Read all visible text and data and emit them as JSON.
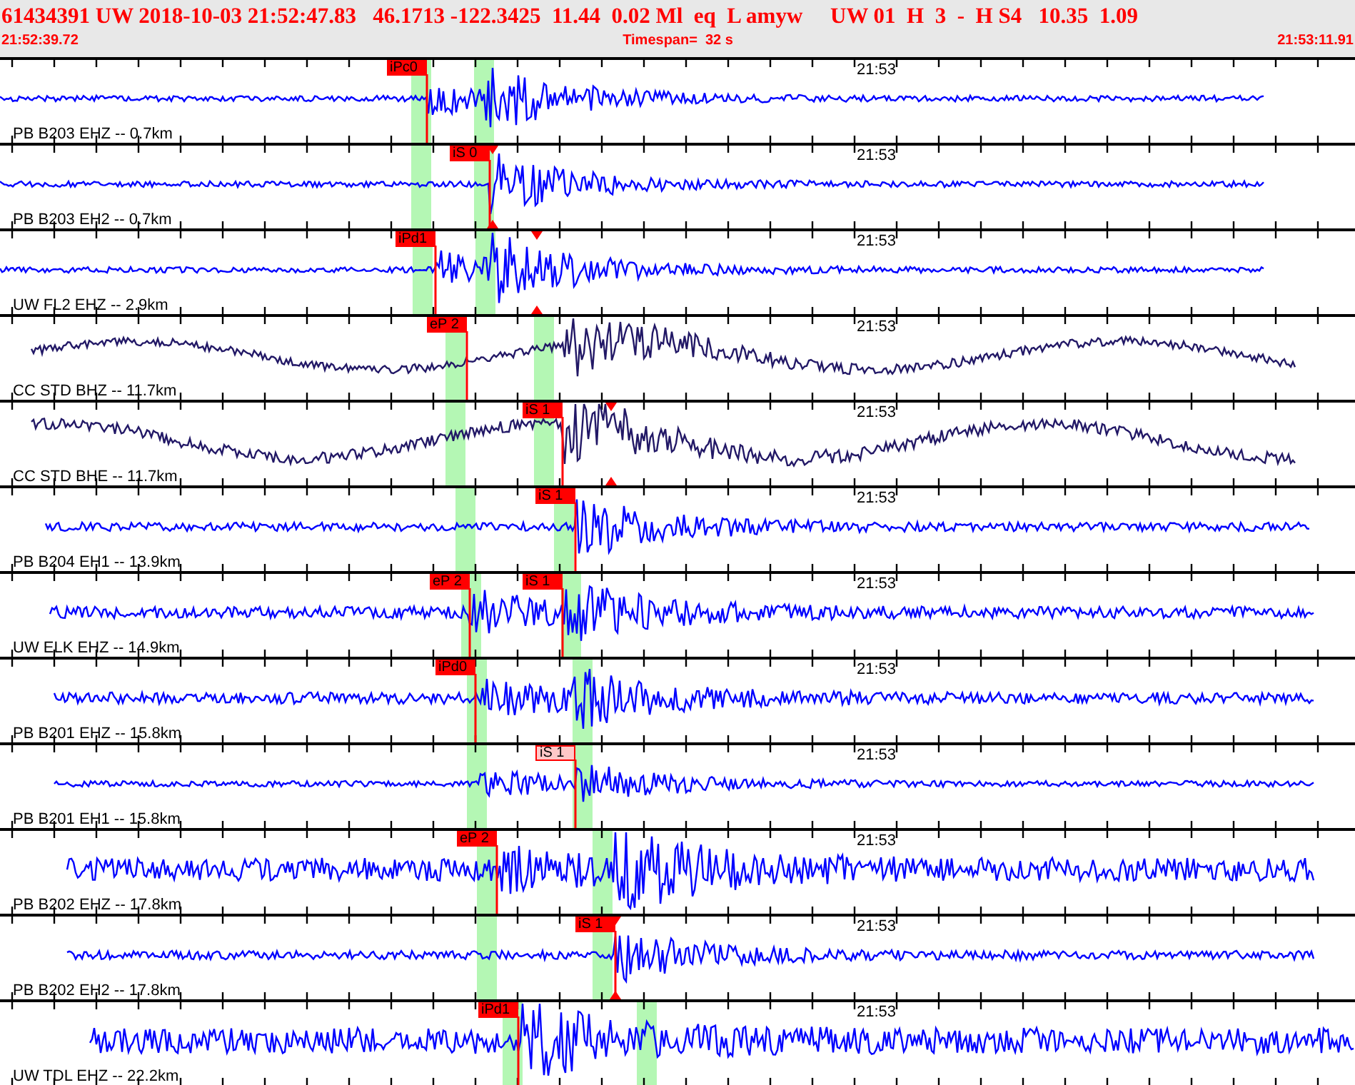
{
  "event_line": "61434391 UW 2018-10-03 21:52:47.83   46.1713 -122.3425  11.44  0.02 Ml  eq  L amyw     UW 01  H  3  -  H S4   10.35  1.09",
  "start_time": "21:52:39.72",
  "timespan": "Timespan=  32 s",
  "end_time": "21:53:11.91",
  "traces": [
    {
      "station": "PB B203 EHZ -- 0.7km",
      "time_label": "21:53",
      "color": "#0000ff",
      "picks": [
        {
          "label": "iPc0",
          "confirmed": true
        }
      ]
    },
    {
      "station": "PB B203 EH2 -- 0.7km",
      "time_label": "21:53",
      "color": "#0000ff",
      "picks": [
        {
          "label": "iS 0",
          "confirmed": true
        }
      ]
    },
    {
      "station": "UW FL2 EHZ -- 2.9km",
      "time_label": "21:53",
      "color": "#0000ff",
      "picks": [
        {
          "label": "iPd1",
          "confirmed": true
        }
      ]
    },
    {
      "station": "CC STD BHZ -- 11.7km",
      "time_label": "21:53",
      "color": "#221866",
      "picks": [
        {
          "label": "eP 2",
          "confirmed": true
        }
      ]
    },
    {
      "station": "CC STD BHE -- 11.7km",
      "time_label": "21:53",
      "color": "#221866",
      "picks": [
        {
          "label": "iS 1",
          "confirmed": true
        }
      ]
    },
    {
      "station": "PB B204 EH1 -- 13.9km",
      "time_label": "21:53",
      "color": "#0000ff",
      "picks": [
        {
          "label": "iS 1",
          "confirmed": true
        }
      ]
    },
    {
      "station": "UW ELK EHZ -- 14.9km",
      "time_label": "21:53",
      "color": "#0000ff",
      "picks": [
        {
          "label": "eP 2",
          "confirmed": true
        },
        {
          "label": "iS 1",
          "confirmed": true
        }
      ]
    },
    {
      "station": "PB B201 EHZ -- 15.8km",
      "time_label": "21:53",
      "color": "#0000ff",
      "picks": [
        {
          "label": "iPd0",
          "confirmed": true
        }
      ]
    },
    {
      "station": "PB B201 EH1 -- 15.8km",
      "time_label": "21:53",
      "color": "#0000ff",
      "picks": [
        {
          "label": "iS 1",
          "confirmed": false
        }
      ]
    },
    {
      "station": "PB B202 EHZ -- 17.8km",
      "time_label": "21:53",
      "color": "#0000ff",
      "picks": [
        {
          "label": "eP 2",
          "confirmed": true
        }
      ]
    },
    {
      "station": "PB B202 EH2 -- 17.8km",
      "time_label": "21:53",
      "color": "#0000ff",
      "picks": [
        {
          "label": "iS 1",
          "confirmed": true
        }
      ]
    },
    {
      "station": "UW TDL EHZ -- 22.2km",
      "time_label": "21:53",
      "color": "#0000ff",
      "picks": [
        {
          "label": "iPd1",
          "confirmed": true
        }
      ]
    }
  ]
}
